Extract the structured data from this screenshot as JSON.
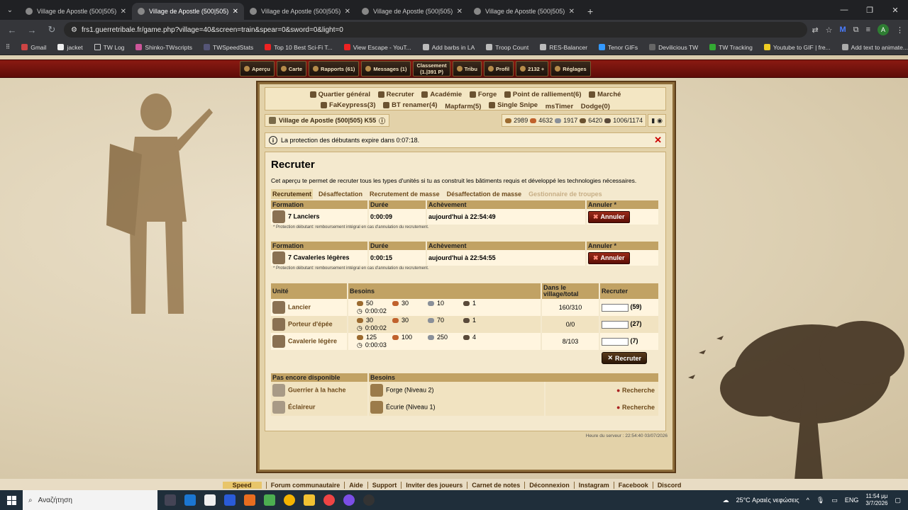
{
  "browser": {
    "tabs": [
      {
        "title": "Village de Apostle (500|505) - G",
        "active": false
      },
      {
        "title": "Village de Apostle (500|505) - G",
        "active": true
      },
      {
        "title": "Village de Apostle (500|505) - G",
        "active": false
      },
      {
        "title": "Village de Apostle (500|505) - G",
        "active": false
      },
      {
        "title": "Village de Apostle (500|505) - G",
        "active": false
      }
    ],
    "url": "frs1.guerretribale.fr/game.php?village=40&screen=train&spear=0&sword=0&light=0",
    "avatar": "A",
    "bookmarks": [
      "Gmail",
      "jacket",
      "TW Log",
      "Shinko-TWscripts",
      "TWSpeedStats",
      "Top 10 Best Sci-Fi T...",
      "View Escape - YouT...",
      "Add barbs in LA",
      "Troop Count",
      "RES-Balancer",
      "Tenor GIFs",
      "Devilicious TW",
      "TW Tracking",
      "Youtube to GIF | fre...",
      "Add text to animate..."
    ]
  },
  "topmenu": {
    "apercu": "Aperçu",
    "carte": "Carte",
    "rapports": "Rapports (61)",
    "messages": "Messages (1)",
    "classement_label": "Classement",
    "classement_value": "(1.|391 P)",
    "tribu": "Tribu",
    "profil": "Profil",
    "points": "2132 +",
    "reglages": "Réglages"
  },
  "mainmenu": {
    "row1": [
      "Quartier général",
      "Recruter",
      "Académie",
      "Forge",
      "Point de ralliement(6)",
      "Marché"
    ],
    "row2": [
      "FaKeypress(3)",
      "BT renamer(4)",
      "Mapfarm(5)",
      "Single Snipe",
      "msTimer",
      "Dodge(0)"
    ]
  },
  "village": {
    "name": "Village de Apostle (500|505) K55",
    "wood": "2989",
    "clay": "4632",
    "iron": "1917",
    "storage": "6420",
    "population": "1006/1174"
  },
  "notice": {
    "text": "La protection des débutants expire dans 0:07:18."
  },
  "page": {
    "title": "Recruter",
    "description": "Cet aperçu te permet de recruter tous les types d'unités si tu as construit les bâtiments requis et développé les technologies nécessaires.",
    "subtabs": [
      "Recrutement",
      "Désaffectation",
      "Recrutement de masse",
      "Désaffectation de masse",
      "Gestionnaire de troupes"
    ]
  },
  "queue_headers": {
    "formation": "Formation",
    "duree": "Durée",
    "achevement": "Achèvement",
    "annuler": "Annuler *"
  },
  "queues": [
    {
      "unit": "7 Lanciers",
      "duration": "0:00:09",
      "done": "aujourd'hui à 22:54:49",
      "cancel": "Annuler",
      "note": "* Protection débutant: remboursement intégral en cas d'annulation du recrutement."
    },
    {
      "unit": "7 Cavaleries légères",
      "duration": "0:00:15",
      "done": "aujourd'hui à 22:54:55",
      "cancel": "Annuler",
      "note": "* Protection débutant: remboursement intégral en cas d'annulation du recrutement."
    }
  ],
  "recruit_headers": {
    "unite": "Unité",
    "besoins": "Besoins",
    "dans_le_village": "Dans le village/total",
    "recruter": "Recruter"
  },
  "units": [
    {
      "name": "Lancier",
      "wood": "50",
      "clay": "30",
      "iron": "10",
      "pop": "1",
      "time": "0:00:02",
      "count": "160/310",
      "max": "(59)"
    },
    {
      "name": "Porteur d'épée",
      "wood": "30",
      "clay": "30",
      "iron": "70",
      "pop": "1",
      "time": "0:00:02",
      "count": "0/0",
      "max": "(27)"
    },
    {
      "name": "Cavalerie légère",
      "wood": "125",
      "clay": "100",
      "iron": "250",
      "pop": "4",
      "time": "0:00:03",
      "count": "8/103",
      "max": "(7)"
    }
  ],
  "recruit_button": "Recruter",
  "unavailable_headers": {
    "pas_encore": "Pas encore disponible",
    "besoins": "Besoins"
  },
  "unavailable": [
    {
      "name": "Guerrier à la hache",
      "need": "Forge (Niveau 2)",
      "action": "Recherche"
    },
    {
      "name": "Éclaireur",
      "need": "Écurie (Niveau 1)",
      "action": "Recherche"
    }
  ],
  "server_time": "Heure du serveur : 22:54:40 03/07/2026",
  "footer": [
    "Speed",
    "Forum communautaire",
    "Aide",
    "Support",
    "Inviter des joueurs",
    "Carnet de notes",
    "Déconnexion",
    "Instagram",
    "Facebook",
    "Discord"
  ],
  "taskbar": {
    "search": "Αναζήτηση",
    "weather": "25°C Αραιές νεφώσεις",
    "lang": "ENG",
    "time": "11:54 μμ",
    "date": "3/7/2026"
  },
  "colors": {
    "wood": "#9b6a2f",
    "clay": "#c0612c",
    "iron": "#8a9099",
    "accent": "#c1a264"
  }
}
